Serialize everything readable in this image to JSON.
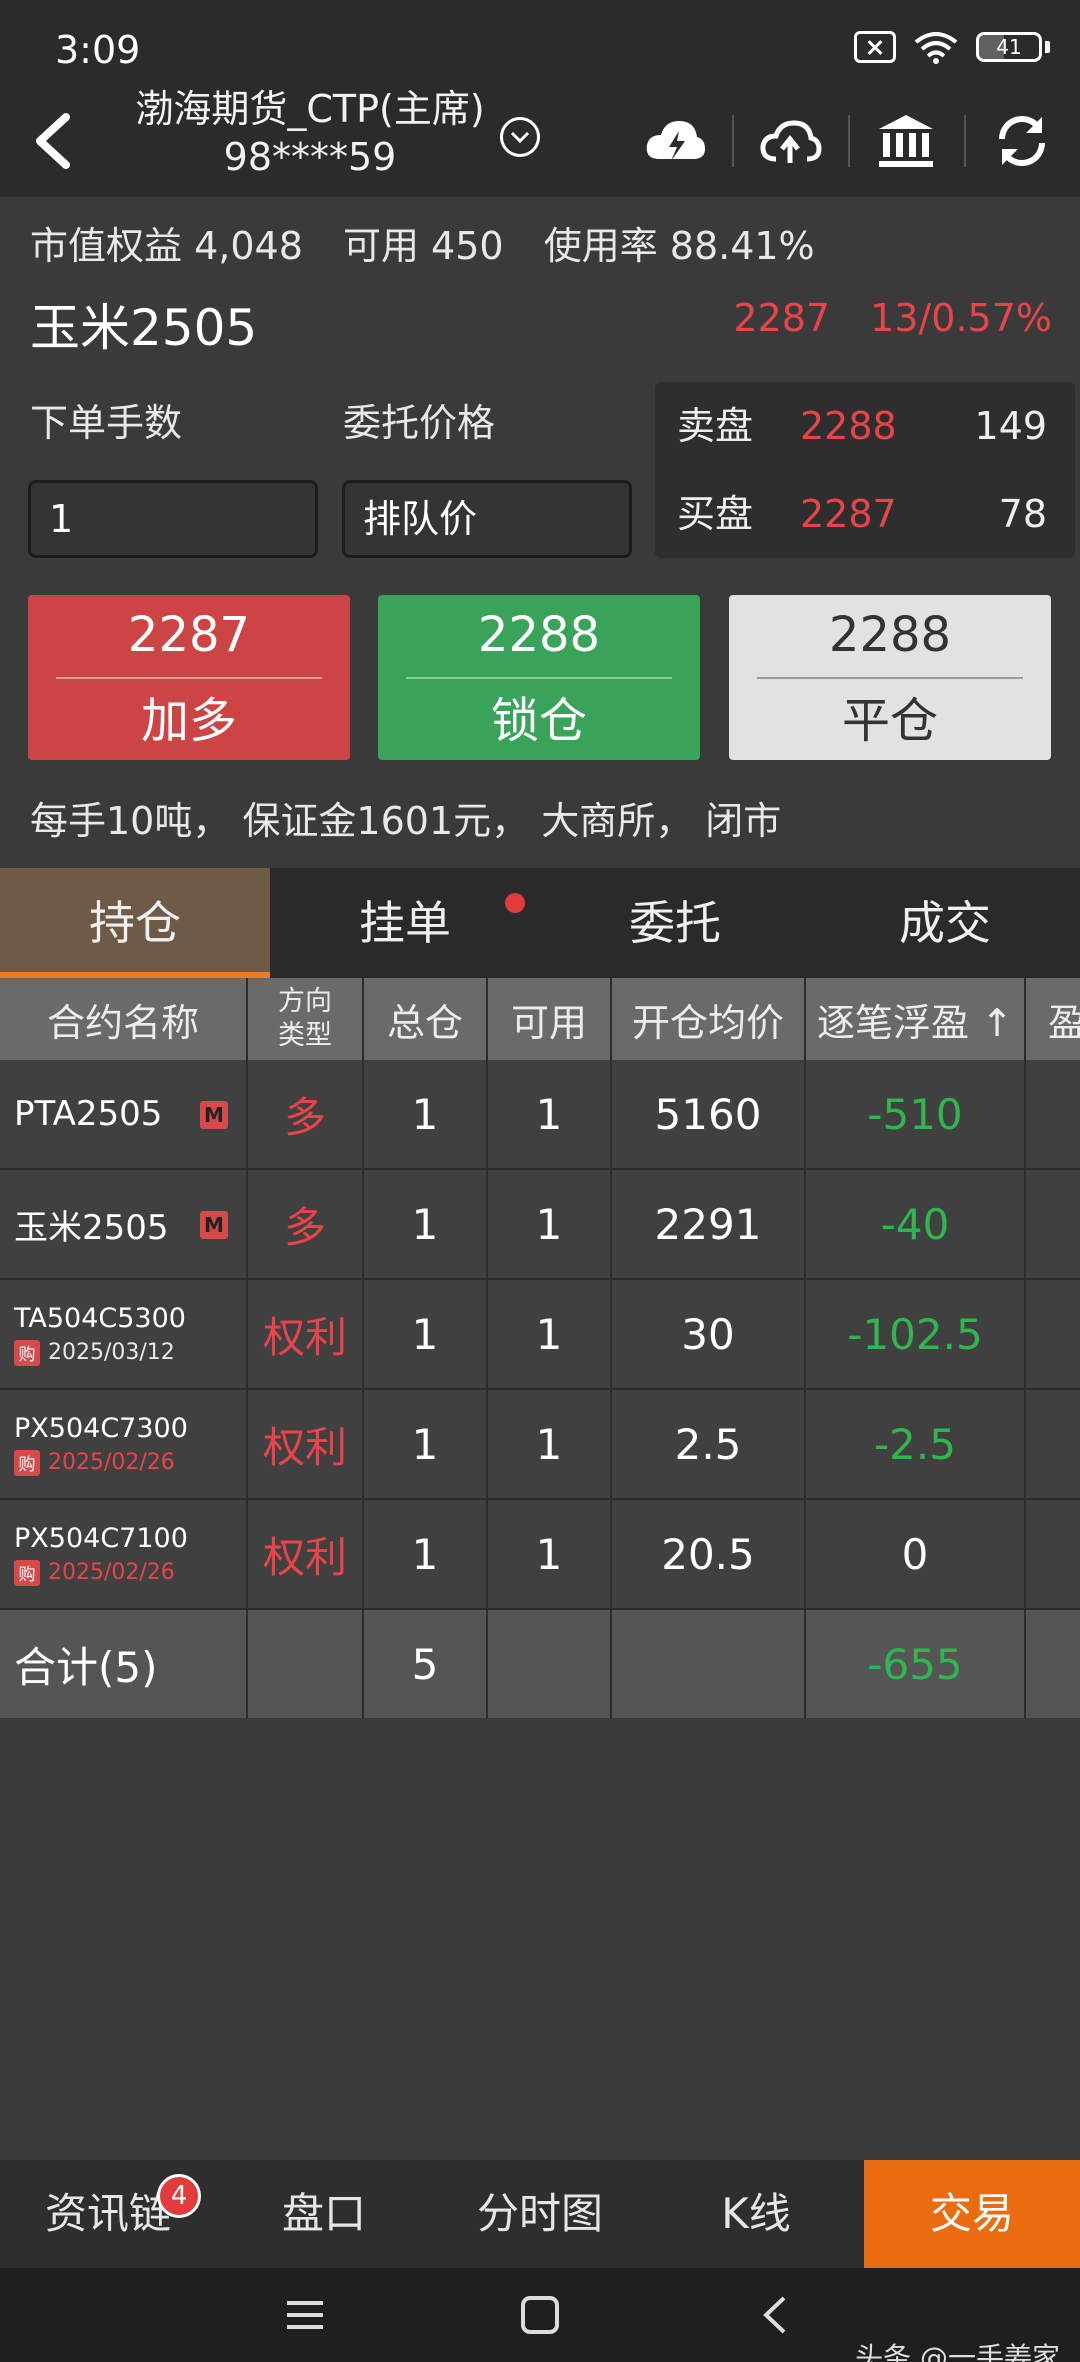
{
  "status_bar": {
    "time": "3:09",
    "battery": "41",
    "battery_level": 0.41
  },
  "header": {
    "broker": "渤海期货_CTP(主席)",
    "account": "98****59"
  },
  "account_summary": {
    "equity": "市值权益 4,048",
    "available": "可用 450",
    "usage": "使用率 88.41%"
  },
  "contract": {
    "name": "玉米2505",
    "last_price": "2287",
    "change": "13/0.57%"
  },
  "order_form": {
    "qty_label": "下单手数",
    "price_label": "委托价格",
    "qty_value": "1",
    "price_type": "排队价"
  },
  "order_book": {
    "ask_label": "卖盘",
    "ask_price": "2288",
    "ask_vol": "149",
    "bid_label": "买盘",
    "bid_price": "2287",
    "bid_vol": "78"
  },
  "actions": {
    "add_long": {
      "price": "2287",
      "label": "加多"
    },
    "lock": {
      "price": "2288",
      "label": "锁仓"
    },
    "close": {
      "price": "2288",
      "label": "平仓"
    }
  },
  "contract_info": "每手10吨， 保证金1601元， 大商所， 闭市",
  "tabs": [
    "持仓",
    "挂单",
    "委托",
    "成交"
  ],
  "table": {
    "headers": {
      "name": "合约名称",
      "dir_line1": "方向",
      "dir_line2": "类型",
      "total": "总仓",
      "avail": "可用",
      "avg": "开仓均价",
      "float": "逐笔浮盈 ↑",
      "extra": "盈"
    },
    "rows": [
      {
        "name": "PTA2505",
        "tag": "M",
        "dir": "多",
        "total": "1",
        "avail": "1",
        "avg": "5160",
        "float": "-510"
      },
      {
        "name": "玉米2505",
        "tag": "M",
        "dir": "多",
        "total": "1",
        "avail": "1",
        "avg": "2291",
        "float": "-40"
      },
      {
        "name": "TA504C5300",
        "buy": "购",
        "date": "2025/03/12",
        "dir": "权利",
        "total": "1",
        "avail": "1",
        "avg": "30",
        "float": "-102.5"
      },
      {
        "name": "PX504C7300",
        "buy": "购",
        "date": "2025/02/26",
        "dir": "权利",
        "total": "1",
        "avail": "1",
        "avg": "2.5",
        "float": "-2.5"
      },
      {
        "name": "PX504C7100",
        "buy": "购",
        "date": "2025/02/26",
        "dir": "权利",
        "total": "1",
        "avail": "1",
        "avg": "20.5",
        "float": "0"
      }
    ],
    "total_row": {
      "label": "合计(5)",
      "total": "5",
      "float": "-655"
    }
  },
  "bottom_nav": {
    "items": [
      "资讯链",
      "盘口",
      "分时图",
      "K线",
      "交易"
    ],
    "badge": "4"
  },
  "watermark": "头条 @一手姜家",
  "colors": {
    "up_red": "#e8444a",
    "down_green": "#2fb64e",
    "accent_orange": "#ea6c0f"
  }
}
